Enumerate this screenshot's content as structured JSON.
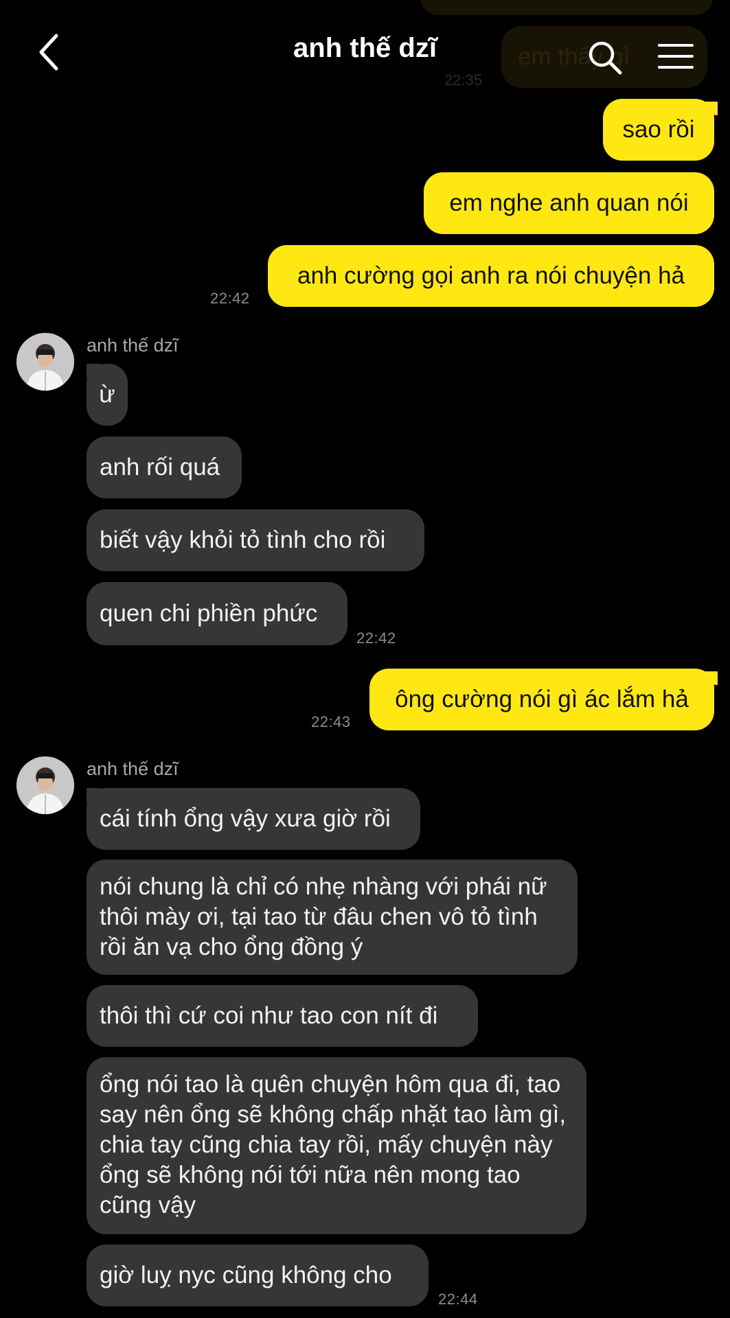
{
  "header": {
    "title": "anh thế dzĩ",
    "back_icon": "chevron-left-icon",
    "search_icon": "search-icon",
    "menu_icon": "menu-icon"
  },
  "colors": {
    "background": "#000000",
    "outgoing_bubble": "#ffe812",
    "incoming_bubble": "#363638",
    "timestamp": "#8d8d8d"
  },
  "ghost": {
    "message": "em thấy gì",
    "time": "22:35"
  },
  "outgoing_group_1": {
    "messages": [
      "sao rồi",
      "em nghe anh quan nói",
      "anh cường gọi anh ra nói chuyện hả"
    ],
    "time": "22:42"
  },
  "incoming_group_1": {
    "sender": "anh thế dzĩ",
    "messages": [
      "ừ",
      "anh rối quá",
      "biết vậy khỏi tỏ tình cho rồi",
      "quen chi phiền phức"
    ],
    "time": "22:42"
  },
  "outgoing_group_2": {
    "messages": [
      "ông cường nói gì ác lắm hả"
    ],
    "time": "22:43"
  },
  "incoming_group_2": {
    "sender": "anh thế dzĩ",
    "messages": [
      "cái tính ổng vậy xưa giờ rồi",
      "nói chung là chỉ có nhẹ nhàng với phái nữ thôi mày ơi, tại tao từ đâu chen vô tỏ tình rồi ăn vạ cho ổng đồng ý",
      "thôi thì cứ coi như tao con nít đi",
      "ổng nói tao là quên chuyện hôm qua đi, tao say nên ổng sẽ không chấp nhặt tao làm gì, chia tay cũng chia tay rồi, mấy chuyện này ổng sẽ không nói tới nữa nên mong tao cũng vậy",
      "giờ luỵ nyc cũng không cho"
    ],
    "time": "22:44"
  }
}
